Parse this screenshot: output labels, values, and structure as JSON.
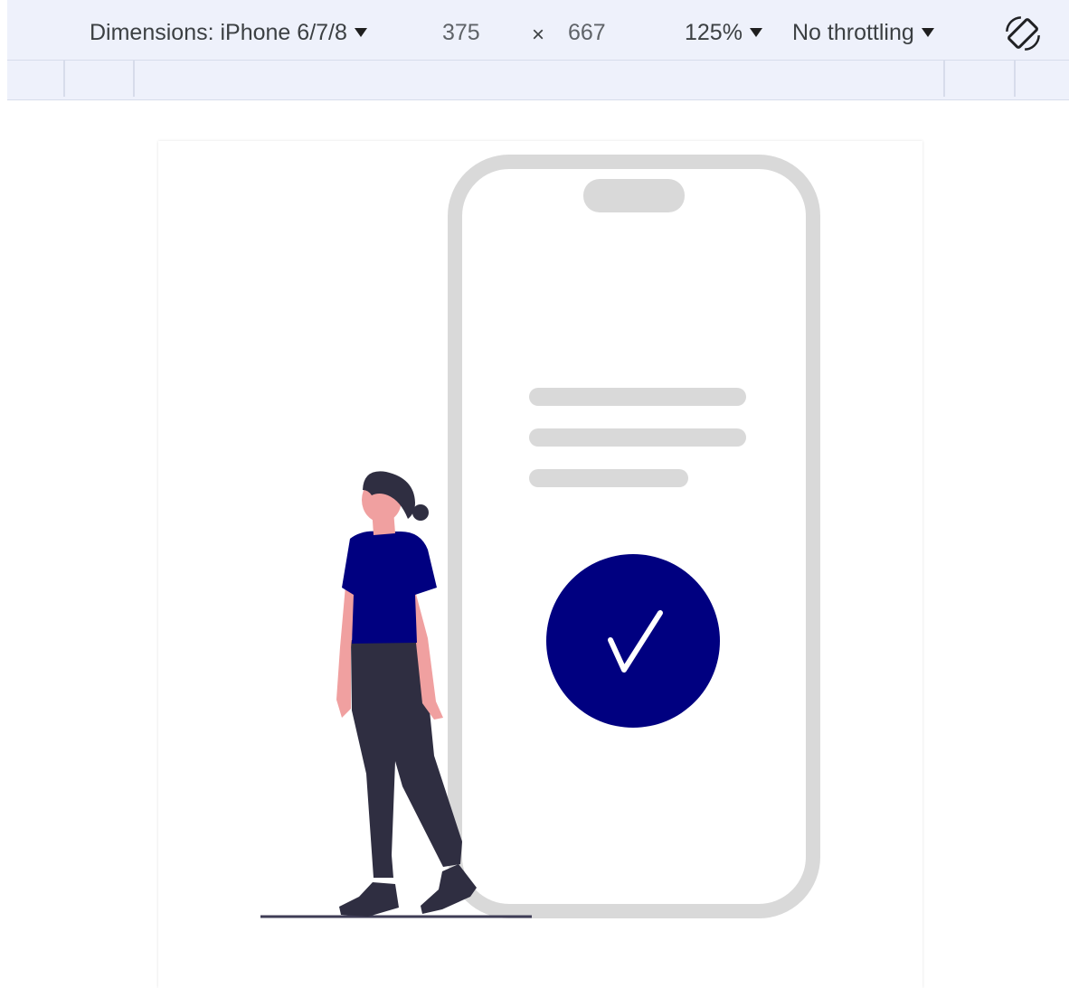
{
  "toolbar": {
    "dimensions_label": "Dimensions: iPhone 6/7/8",
    "width_value": "375",
    "times_symbol": "×",
    "height_value": "667",
    "zoom_label": "125%",
    "throttling_label": "No throttling",
    "rotate_icon": "rotate-icon"
  },
  "colors": {
    "toolbar_bg": "#eef1fb",
    "accent": "#000080",
    "phone_outline": "#d9d9d9",
    "placeholder_line": "#d9d9d9",
    "pants": "#2f2e41",
    "skin": "#f0a0a0"
  },
  "illustration": {
    "name": "phone-confirmation-illustration",
    "icons": [
      "check-icon",
      "phone-icon",
      "person-icon"
    ]
  }
}
